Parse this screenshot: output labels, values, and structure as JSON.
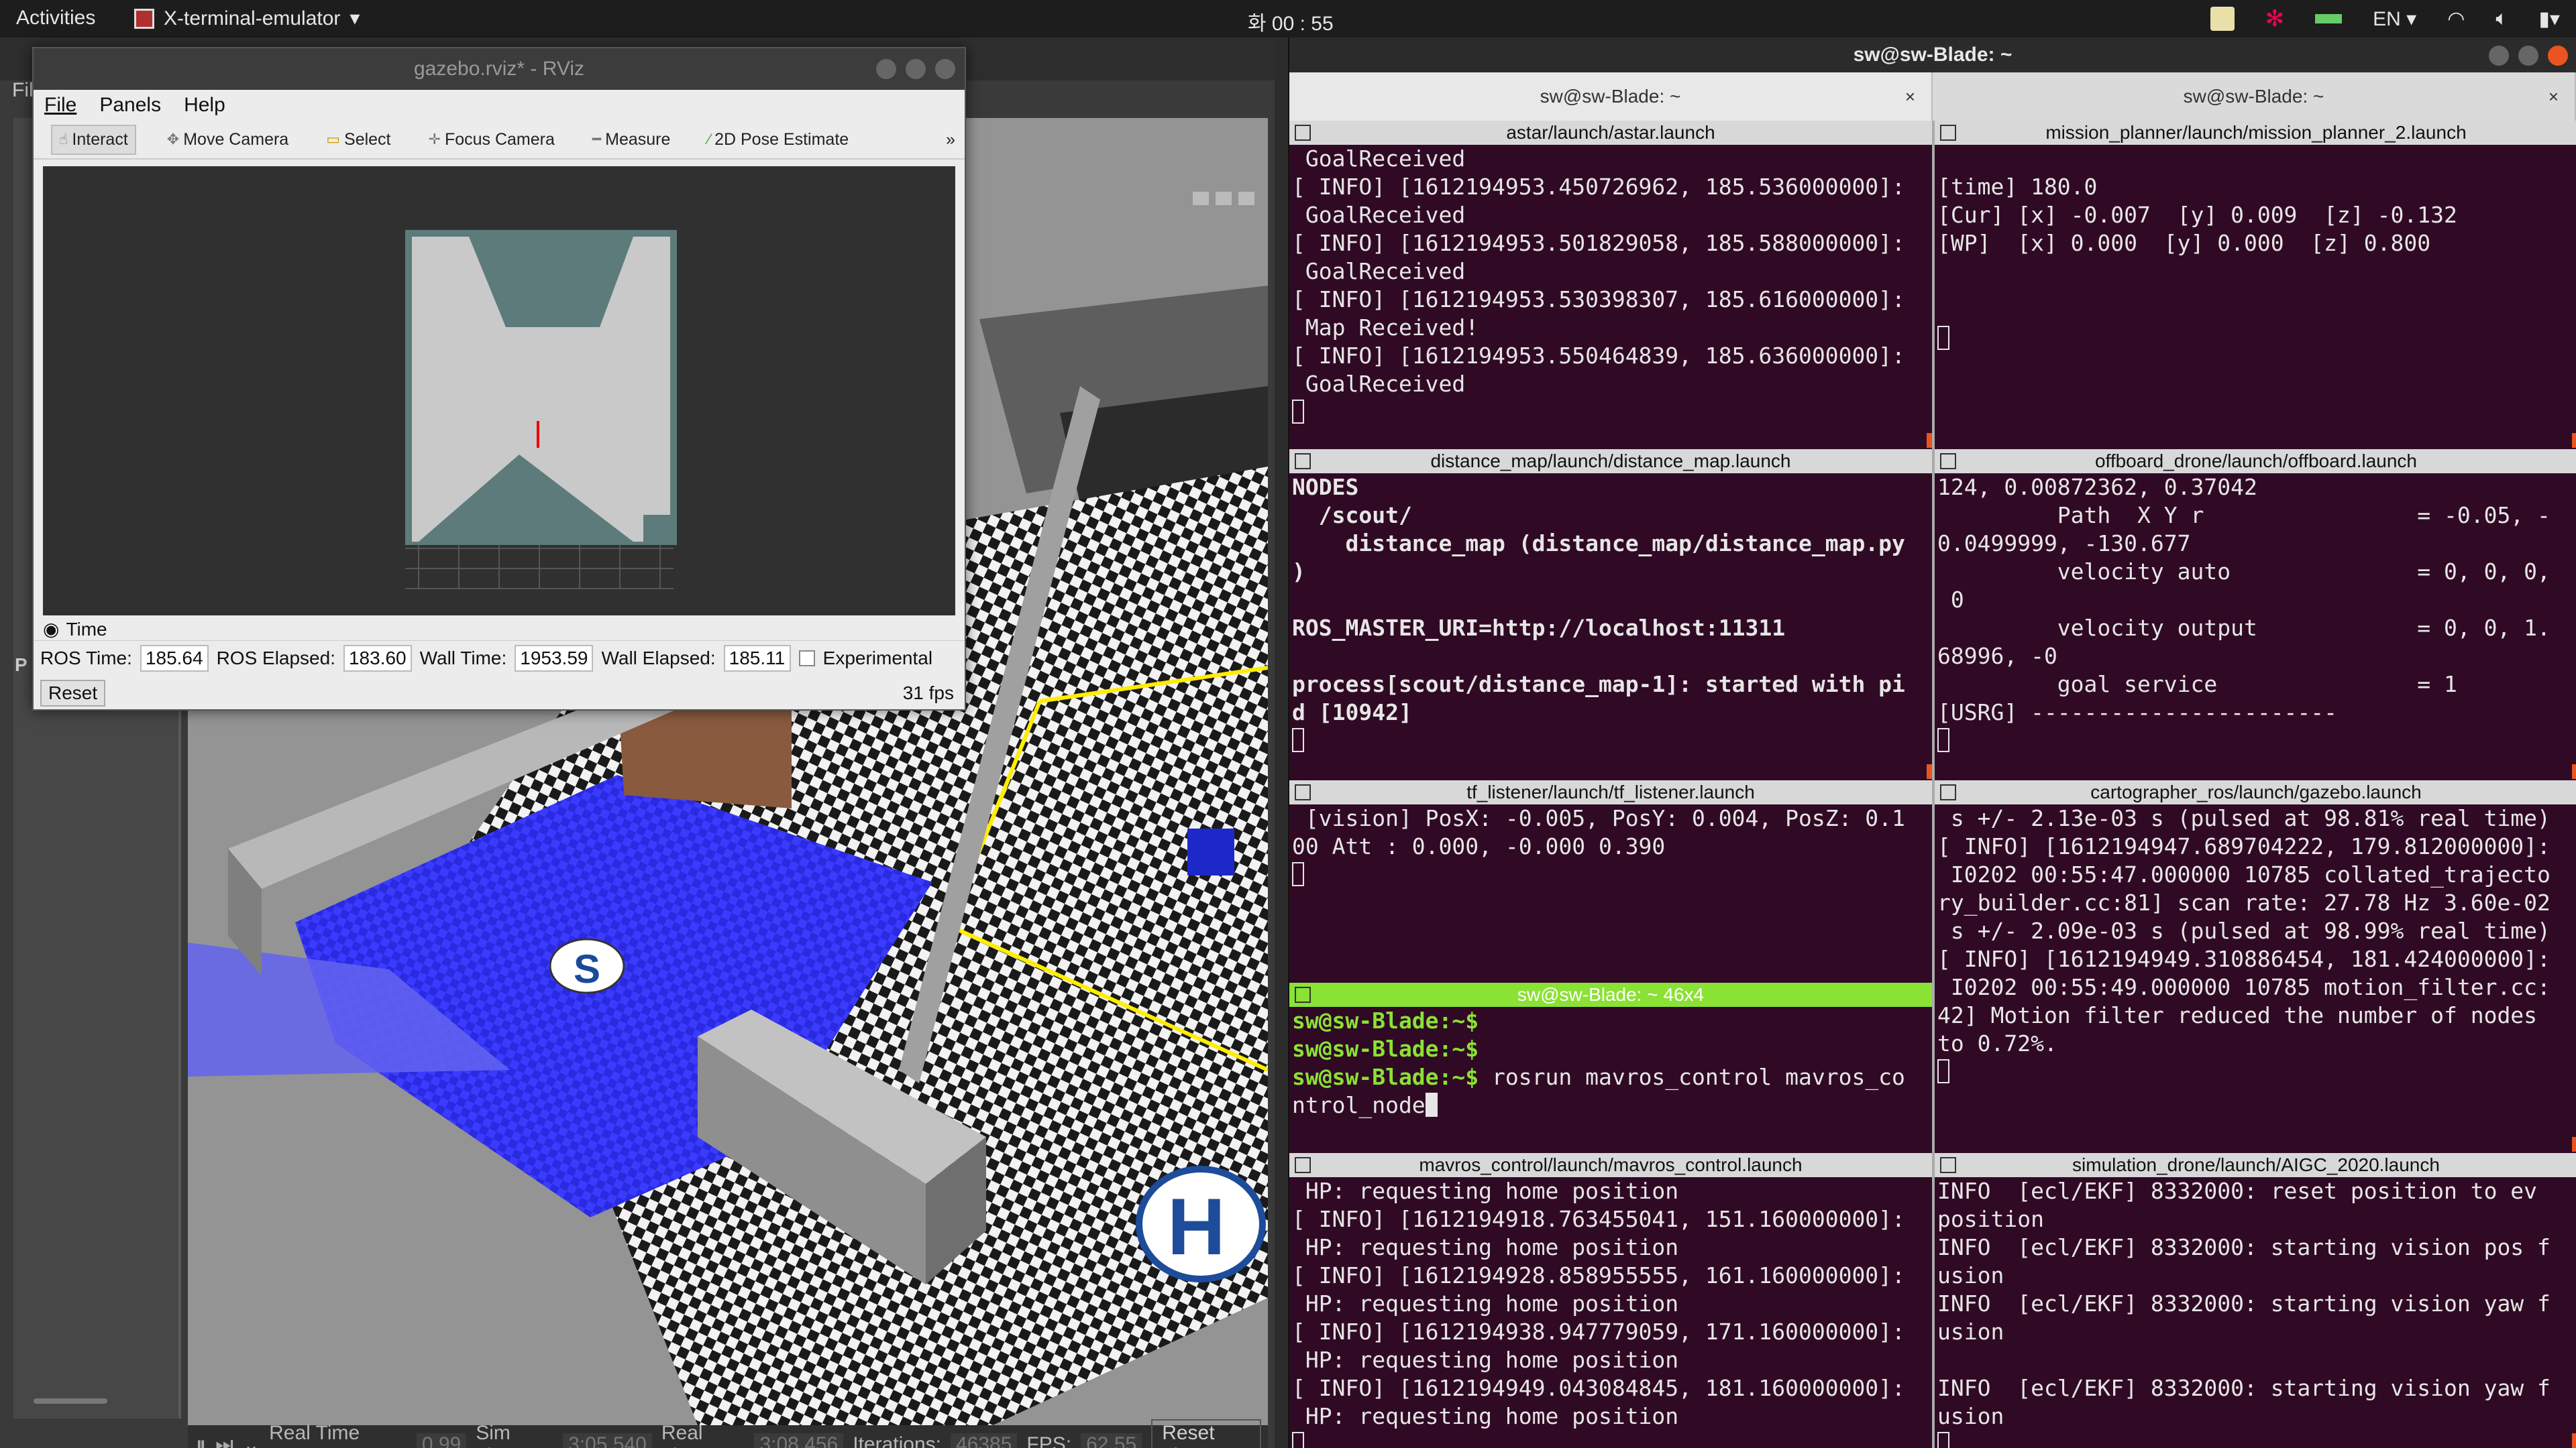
{
  "topbar": {
    "activities": "Activities",
    "app_name": "X-terminal-emulator",
    "clock": "화 00 : 55",
    "lang": "EN"
  },
  "rviz": {
    "title": "gazebo.rviz* - RViz",
    "menu": [
      "File",
      "Panels",
      "Help"
    ],
    "tools": [
      "Interact",
      "Move Camera",
      "Select",
      "Focus Camera",
      "Measure",
      "2D Pose Estimate"
    ],
    "time_panel": {
      "header": "Time",
      "ros_time_label": "ROS Time:",
      "ros_time": "185.64",
      "ros_elapsed_label": "ROS Elapsed:",
      "ros_elapsed": "183.60",
      "wall_time_label": "Wall Time:",
      "wall_time": "1953.59",
      "wall_elapsed_label": "Wall Elapsed:",
      "wall_elapsed": "185.11",
      "experimental": "Experimental",
      "reset": "Reset",
      "fps": "31 fps"
    }
  },
  "gazebo": {
    "file_menu": "Fil",
    "left_letter": "P",
    "bottombar": {
      "rtf_label": "Real Time Factor:",
      "rtf": "0.99",
      "sim_time_label": "Sim Time:",
      "sim_time": "3:05.540",
      "real_time_label": "Real Time:",
      "real_time": "3:08.456",
      "iterations_label": "Iterations:",
      "iterations": "46385",
      "fps_label": "FPS:",
      "fps": "62.55",
      "reset_time": "Reset Time"
    },
    "scene": {
      "helipad_letter": "H",
      "robot_letter": "S"
    }
  },
  "terminal": {
    "title": "sw@sw-Blade: ~",
    "tabs": [
      "sw@sw-Blade: ~",
      "sw@sw-Blade: ~"
    ],
    "panes": {
      "astar": {
        "header": "astar/launch/astar.launch",
        "text": " GoalReceived\n[ INFO] [1612194953.450726962, 185.536000000]:\n GoalReceived\n[ INFO] [1612194953.501829058, 185.588000000]:\n GoalReceived\n[ INFO] [1612194953.530398307, 185.616000000]:\n Map Received!\n[ INFO] [1612194953.550464839, 185.636000000]:\n GoalReceived"
      },
      "mission": {
        "header": "mission_planner/launch/mission_planner_2.launch",
        "text": "\n[time] 180.0\n[Cur] [x] -0.007  [y] 0.009  [z] -0.132\n[WP]  [x] 0.000  [y] 0.000  [z] 0.800"
      },
      "distance": {
        "header": "distance_map/launch/distance_map.launch",
        "text": "NODES\n  /scout/\n    distance_map (distance_map/distance_map.py\n)\n\nROS_MASTER_URI=http://localhost:11311\n\nprocess[scout/distance_map-1]: started with pi\nd [10942]"
      },
      "offboard": {
        "header": "offboard_drone/launch/offboard.launch",
        "text": "124, 0.00872362, 0.37042\n         Path  X Y r                = -0.05, -\n0.0499999, -130.677\n         velocity auto              = 0, 0, 0,\n 0\n         velocity output            = 0, 0, 1.\n68996, -0\n         goal service               = 1\n[USRG] -----------------------"
      },
      "tf": {
        "header": "tf_listener/launch/tf_listener.launch",
        "text": " [vision] PosX: -0.005, PosY: 0.004, PosZ: 0.1\n00 Att : 0.000, -0.000 0.390"
      },
      "cartographer": {
        "header": "cartographer_ros/launch/gazebo.launch",
        "text": " s +/- 2.13e-03 s (pulsed at 98.81% real time)\n[ INFO] [1612194947.689704222, 179.812000000]:\n I0202 00:55:47.000000 10785 collated_trajecto\nry_builder.cc:81] scan rate: 27.78 Hz 3.60e-02\n s +/- 2.09e-03 s (pulsed at 98.99% real time)\n[ INFO] [1612194949.310886454, 181.424000000]:\n I0202 00:55:49.000000 10785 motion_filter.cc:\n42] Motion filter reduced the number of nodes\nto 0.72%."
      },
      "shell": {
        "header": "sw@sw-Blade: ~ 46x4",
        "prompt": "sw@sw-Blade:~$",
        "command_line1": " rosrun mavros_control mavros_co",
        "command_line2": "ntrol_node"
      },
      "mavros": {
        "header": "mavros_control/launch/mavros_control.launch",
        "text": " HP: requesting home position\n[ INFO] [1612194918.763455041, 151.160000000]:\n HP: requesting home position\n[ INFO] [1612194928.858955555, 161.160000000]:\n HP: requesting home position\n[ INFO] [1612194938.947779059, 171.160000000]:\n HP: requesting home position\n[ INFO] [1612194949.043084845, 181.160000000]:\n HP: requesting home position"
      },
      "simulation": {
        "header": "simulation_drone/launch/AIGC_2020.launch",
        "text": "INFO  [ecl/EKF] 8332000: reset position to ev\nposition\nINFO  [ecl/EKF] 8332000: starting vision pos f\nusion\nINFO  [ecl/EKF] 8332000: starting vision yaw f\nusion\n\nINFO  [ecl/EKF] 8332000: starting vision yaw f\nusion"
      }
    }
  },
  "colors": {
    "terminal_bg": "#300a24",
    "active_pane": "#8ae234",
    "ubuntu_orange": "#e95420"
  }
}
